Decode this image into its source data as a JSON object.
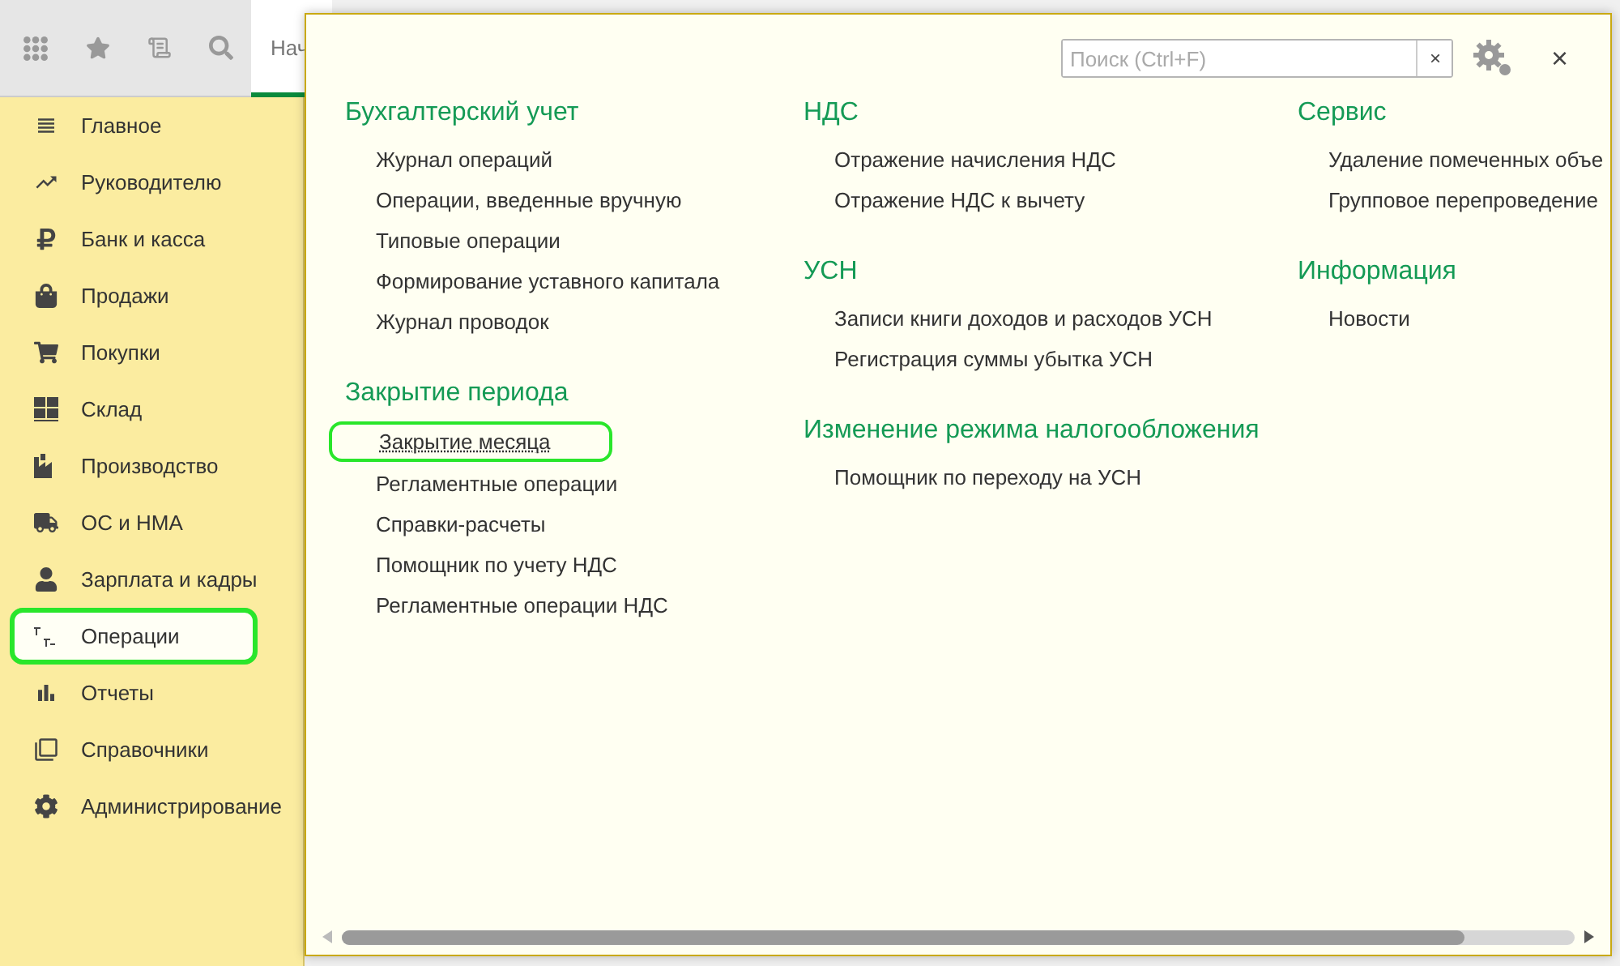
{
  "top_tab": {
    "label": "Нач",
    "selected": true
  },
  "sidebar": {
    "items": [
      {
        "label": "Главное",
        "selected": false,
        "highlighted": false
      },
      {
        "label": "Руководителю",
        "selected": false,
        "highlighted": false
      },
      {
        "label": "Банк и касса",
        "selected": false,
        "highlighted": false
      },
      {
        "label": "Продажи",
        "selected": false,
        "highlighted": false
      },
      {
        "label": "Покупки",
        "selected": false,
        "highlighted": false
      },
      {
        "label": "Склад",
        "selected": false,
        "highlighted": false
      },
      {
        "label": "Производство",
        "selected": false,
        "highlighted": false
      },
      {
        "label": "ОС и НМА",
        "selected": false,
        "highlighted": false
      },
      {
        "label": "Зарплата и кадры",
        "selected": false,
        "highlighted": false
      },
      {
        "label": "Операции",
        "selected": true,
        "highlighted": true
      },
      {
        "label": "Отчеты",
        "selected": false,
        "highlighted": false
      },
      {
        "label": "Справочники",
        "selected": false,
        "highlighted": false
      },
      {
        "label": "Администрирование",
        "selected": false,
        "highlighted": false
      }
    ]
  },
  "panel": {
    "search": {
      "placeholder": "Поиск (Ctrl+F)",
      "clear": "×"
    },
    "close": "×",
    "columns": [
      {
        "groups": [
          {
            "title": "Бухгалтерский учет",
            "links": [
              {
                "label": "Журнал операций",
                "highlighted": false
              },
              {
                "label": "Операции, введенные вручную",
                "highlighted": false
              },
              {
                "label": "Типовые операции",
                "highlighted": false
              },
              {
                "label": "Формирование уставного капитала",
                "highlighted": false
              },
              {
                "label": "Журнал проводок",
                "highlighted": false
              }
            ]
          },
          {
            "title": "Закрытие периода",
            "links": [
              {
                "label": "Закрытие месяца",
                "highlighted": true
              },
              {
                "label": "Регламентные операции",
                "highlighted": false
              },
              {
                "label": "Справки-расчеты",
                "highlighted": false
              },
              {
                "label": "Помощник по учету НДС",
                "highlighted": false
              },
              {
                "label": "Регламентные операции НДС",
                "highlighted": false
              }
            ]
          }
        ]
      },
      {
        "groups": [
          {
            "title": "НДС",
            "links": [
              {
                "label": "Отражение начисления НДС",
                "highlighted": false
              },
              {
                "label": "Отражение НДС к вычету",
                "highlighted": false
              }
            ]
          },
          {
            "title": "УСН",
            "links": [
              {
                "label": "Записи книги доходов и расходов УСН",
                "highlighted": false
              },
              {
                "label": "Регистрация суммы убытка УСН",
                "highlighted": false
              }
            ]
          },
          {
            "title": "Изменение режима налогообложения",
            "links": [
              {
                "label": "Помощник по переходу на УСН",
                "highlighted": false
              }
            ]
          }
        ]
      },
      {
        "groups": [
          {
            "title": "Сервис",
            "links": [
              {
                "label": "Удаление помеченных объе",
                "highlighted": false
              },
              {
                "label": "Групповое перепроведение",
                "highlighted": false
              }
            ]
          },
          {
            "title": "Информация",
            "links": [
              {
                "label": "Новости",
                "highlighted": false
              }
            ]
          }
        ]
      }
    ]
  }
}
